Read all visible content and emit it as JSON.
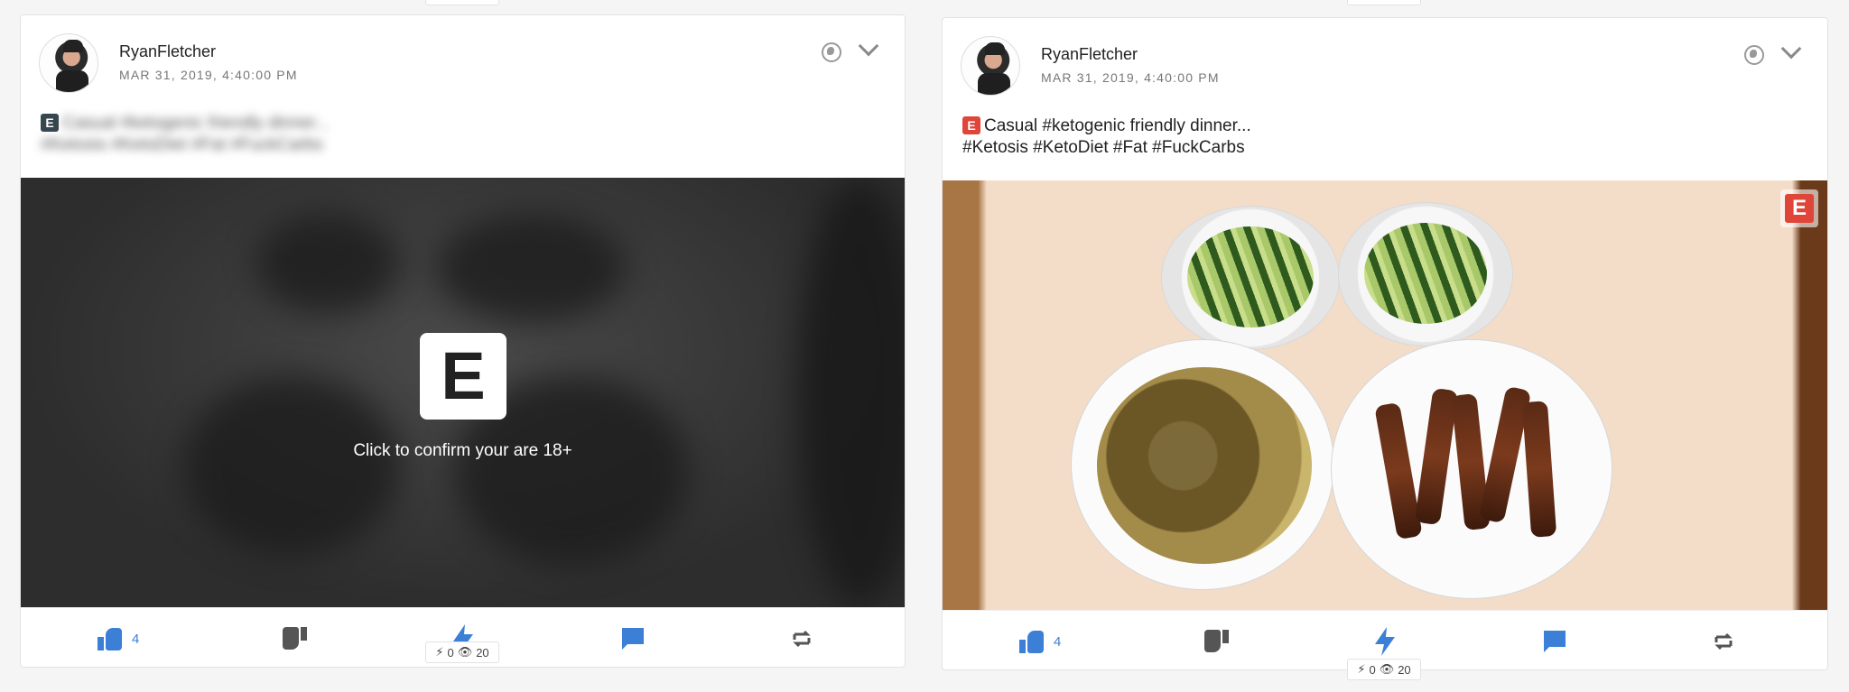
{
  "posts": [
    {
      "username": "RyanFletcher",
      "timestamp": "MAR 31, 2019, 4:40:00 PM",
      "caption_line1": "Casual #ketogenic friendly dinner...",
      "caption_line2": "#Ketosis #KetoDiet #Fat #FuckCarbs",
      "nsfw_badge": "E",
      "nsfw_badge_color": "#37474f",
      "gate_letter": "E",
      "gate_text": "Click to confirm your are 18+",
      "likes": "4",
      "boosts": "0",
      "views": "20",
      "icons": [
        "globe-icon",
        "chevron-down-icon",
        "thumb-up-icon",
        "thumb-down-icon",
        "bolt-icon",
        "comment-icon",
        "repost-icon",
        "eye-icon"
      ]
    },
    {
      "username": "RyanFletcher",
      "timestamp": "MAR 31, 2019, 4:40:00 PM",
      "caption_line1": "Casual #ketogenic friendly dinner...",
      "caption_line2": "#Ketosis #KetoDiet #Fat #FuckCarbs",
      "nsfw_badge": "E",
      "nsfw_badge_color": "#e0453a",
      "overlay_badge": "E",
      "likes": "4",
      "boosts": "0",
      "views": "20",
      "icons": [
        "globe-icon",
        "chevron-down-icon",
        "thumb-up-icon",
        "thumb-down-icon",
        "bolt-icon",
        "comment-icon",
        "repost-icon",
        "eye-icon"
      ]
    }
  ],
  "colors": {
    "accent": "#3b7fd6",
    "nsfw_red": "#e0453a"
  }
}
